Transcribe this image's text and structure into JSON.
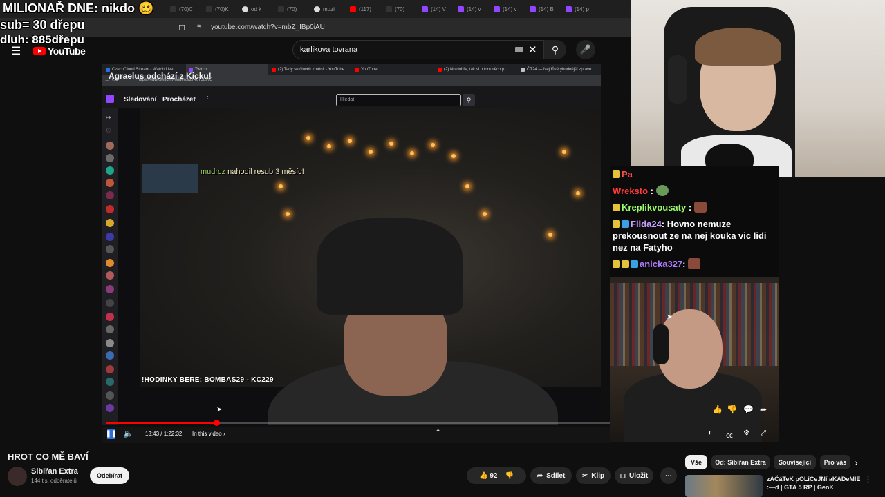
{
  "overlay": {
    "line1": "MILIONAŘ DNE: nikdo",
    "line2": "sub= 30 dřepu",
    "line3": "dluh: 885dřepu"
  },
  "browser": {
    "tabs": [
      "(70)C",
      "(70)K",
      "od k",
      "(70)",
      "muzi",
      "(117)",
      "(70)",
      "(14) V",
      "(14) v",
      "(14) v",
      "(14) B",
      "(14) p"
    ],
    "url": "youtube.com/watch?v=mbZ_IBp0iAU"
  },
  "youtube": {
    "logo": "YouTube",
    "search_value": "karlikova tovrana",
    "title": "HROT CO MĚ BAVÍ",
    "channel": "Sibiřan Extra",
    "subscribers": "144 tis. odběratelů",
    "subscribe_label": "Odebírat",
    "likes": "92",
    "share_label": "Sdílet",
    "clip_label": "Klip",
    "save_label": "Uložit",
    "timecode": "13:43 / 1:22:32",
    "chapter": "In this video",
    "chips": [
      "Vše",
      "Od: Sibiřan Extra",
      "Související",
      "Pro vás"
    ],
    "recommended": {
      "title": "zAČáTeK pOLiCeJNí aKADeMIE :---d | GTA 5 RP | GenK"
    }
  },
  "embed": {
    "tabs": [
      {
        "label": "CzechCloud Stream - Watch Live",
        "color": "#2b6fdd"
      },
      {
        "label": "Twitch",
        "color": "#9146ff"
      },
      {
        "label": "(2) Tady se člověk změnil - YouTube",
        "color": "#ff0000"
      },
      {
        "label": "YouTube",
        "color": "#ff0000"
      },
      {
        "label": "(2) No dobře, tak si o tom něco p",
        "color": "#ff0000"
      },
      {
        "label": "ČT24 — Nejdůvěryhodnější zpravo",
        "color": "#c0c0c0"
      }
    ],
    "url": "https://www.twitch.tv/videos/2740758965",
    "nav_follow": "Sledování",
    "nav_browse": "Procházet",
    "search_placeholder": "Hledat",
    "alert_title": "Agraelus odchází z Kicku!",
    "sub_user": "mudrcz",
    "sub_text": " nahodil resub",
    "sub_months": " 3 ",
    "sub_suffix": "měsíc!",
    "caption": "!HODINKY BERE: BOMBAS29 - KC229"
  },
  "chat": [
    {
      "user": "Pa",
      "color": "#ff4d4d",
      "text": ""
    },
    {
      "user": "Wreksto",
      "color": "#ff3b3b",
      "text": ""
    },
    {
      "user": "Kreplikvousaty",
      "color": "#9bff6a",
      "text": ""
    },
    {
      "user": "Filda24",
      "color": "#c9a0ff",
      "text": "Hovno nemuze prekousnout ze na nej kouka vic lidi nez na Fatyho"
    },
    {
      "user": "anicka327",
      "color": "#b07cff",
      "text": ""
    }
  ],
  "colors": {
    "youtube_red": "#ff0000",
    "twitch_purple": "#9146ff",
    "background": "#0f0f0f"
  }
}
